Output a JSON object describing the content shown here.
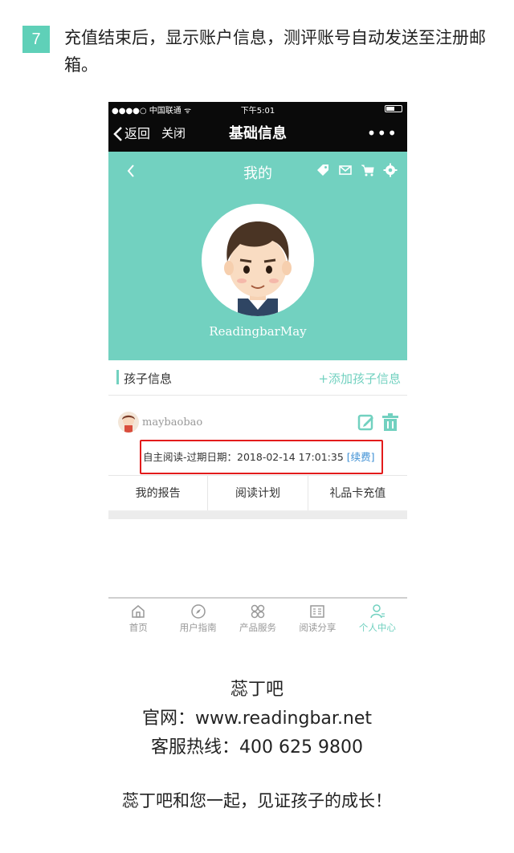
{
  "step": {
    "number": "7",
    "text": "充值结束后，显示账户信息，测评账号自动发送至注册邮箱。"
  },
  "statusbar": {
    "carrier": "●●●●○ 中国联通 ᯤ",
    "time": "下午5:01"
  },
  "navbar": {
    "back": "返回",
    "close": "关闭",
    "title": "基础信息",
    "more": "•••"
  },
  "profile": {
    "title": "我的",
    "username": "ReadingbarMay",
    "icons": [
      "tag-icon",
      "mail-icon",
      "cart-icon",
      "gear-icon"
    ]
  },
  "children_section": {
    "label": "孩子信息",
    "add": "+添加孩子信息"
  },
  "child": {
    "name": "maybaobao",
    "expiry_label": "自主阅读-过期日期：",
    "expiry_date": "2018-02-14 17:01:35",
    "renew": "[续费]"
  },
  "actions": [
    "我的报告",
    "阅读计划",
    "礼品卡充值"
  ],
  "tabbar": [
    {
      "label": "首页",
      "icon": "home-icon"
    },
    {
      "label": "用户指南",
      "icon": "compass-icon"
    },
    {
      "label": "产品服务",
      "icon": "grid-icon"
    },
    {
      "label": "阅读分享",
      "icon": "share-icon"
    },
    {
      "label": "个人中心",
      "icon": "user-icon",
      "active": true
    }
  ],
  "footer": {
    "brand": "蕊丁吧",
    "website": "官网：www.readingbar.net",
    "hotline": "客服热线：400 625 9800",
    "slogan": "蕊丁吧和您一起，见证孩子的成长！"
  },
  "colors": {
    "accent": "#72d1c0",
    "highlight_border": "#e31b1b",
    "link": "#3d8fd4"
  }
}
